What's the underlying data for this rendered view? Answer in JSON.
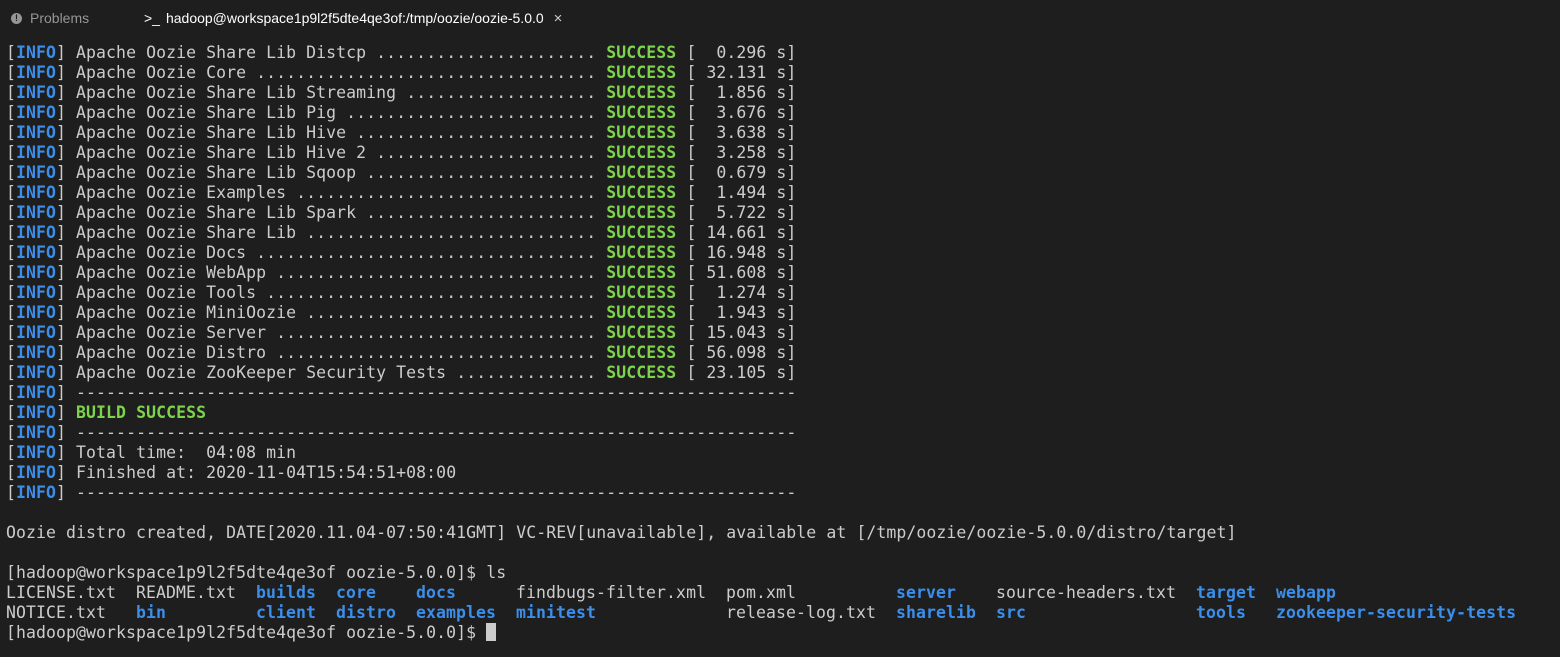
{
  "tabs": {
    "problems": "Problems",
    "terminal_prompt_icon": ">_",
    "terminal": "hadoop@workspace1p9l2f5dte4qe3of:/tmp/oozie/oozie-5.0.0",
    "close": "×"
  },
  "info_tag": "INFO",
  "build_results": [
    {
      "module": "Apache Oozie Share Lib Distcp ",
      "dots": "......................",
      "status": "SUCCESS",
      "time": "[  0.296 s]"
    },
    {
      "module": "Apache Oozie Core ",
      "dots": "..................................",
      "status": "SUCCESS",
      "time": "[ 32.131 s]"
    },
    {
      "module": "Apache Oozie Share Lib Streaming ",
      "dots": "...................",
      "status": "SUCCESS",
      "time": "[  1.856 s]"
    },
    {
      "module": "Apache Oozie Share Lib Pig ",
      "dots": ".........................",
      "status": "SUCCESS",
      "time": "[  3.676 s]"
    },
    {
      "module": "Apache Oozie Share Lib Hive ",
      "dots": "........................",
      "status": "SUCCESS",
      "time": "[  3.638 s]"
    },
    {
      "module": "Apache Oozie Share Lib Hive 2 ",
      "dots": "......................",
      "status": "SUCCESS",
      "time": "[  3.258 s]"
    },
    {
      "module": "Apache Oozie Share Lib Sqoop ",
      "dots": ".......................",
      "status": "SUCCESS",
      "time": "[  0.679 s]"
    },
    {
      "module": "Apache Oozie Examples ",
      "dots": "..............................",
      "status": "SUCCESS",
      "time": "[  1.494 s]"
    },
    {
      "module": "Apache Oozie Share Lib Spark ",
      "dots": ".......................",
      "status": "SUCCESS",
      "time": "[  5.722 s]"
    },
    {
      "module": "Apache Oozie Share Lib ",
      "dots": ".............................",
      "status": "SUCCESS",
      "time": "[ 14.661 s]"
    },
    {
      "module": "Apache Oozie Docs ",
      "dots": "..................................",
      "status": "SUCCESS",
      "time": "[ 16.948 s]"
    },
    {
      "module": "Apache Oozie WebApp ",
      "dots": "................................",
      "status": "SUCCESS",
      "time": "[ 51.608 s]"
    },
    {
      "module": "Apache Oozie Tools ",
      "dots": ".................................",
      "status": "SUCCESS",
      "time": "[  1.274 s]"
    },
    {
      "module": "Apache Oozie MiniOozie ",
      "dots": ".............................",
      "status": "SUCCESS",
      "time": "[  1.943 s]"
    },
    {
      "module": "Apache Oozie Server ",
      "dots": "................................",
      "status": "SUCCESS",
      "time": "[ 15.043 s]"
    },
    {
      "module": "Apache Oozie Distro ",
      "dots": "................................",
      "status": "SUCCESS",
      "time": "[ 56.098 s]"
    },
    {
      "module": "Apache Oozie ZooKeeper Security Tests ",
      "dots": "..............",
      "status": "SUCCESS",
      "time": "[ 23.105 s]"
    }
  ],
  "separator": "------------------------------------------------------------------------",
  "build_success": "BUILD SUCCESS",
  "total_time": "Total time:  04:08 min",
  "finished_at": "Finished at: 2020-11-04T15:54:51+08:00",
  "distro_message": "Oozie distro created, DATE[2020.11.04-07:50:41GMT] VC-REV[unavailable], available at [/tmp/oozie/oozie-5.0.0/distro/target]",
  "prompt": "[hadoop@workspace1p9l2f5dte4qe3of oozie-5.0.0]$ ",
  "command": "ls",
  "ls_output": [
    {
      "name": "LICENSE.txt",
      "type": "file"
    },
    {
      "name": "README.txt",
      "type": "file"
    },
    {
      "name": "builds",
      "type": "dir"
    },
    {
      "name": "core",
      "type": "dir"
    },
    {
      "name": "docs",
      "type": "dir"
    },
    {
      "name": "findbugs-filter.xml",
      "type": "file"
    },
    {
      "name": "pom.xml",
      "type": "file"
    },
    {
      "name": "server",
      "type": "dir"
    },
    {
      "name": "source-headers.txt",
      "type": "file"
    },
    {
      "name": "target",
      "type": "dir"
    },
    {
      "name": "webapp",
      "type": "dir"
    },
    {
      "name": "NOTICE.txt",
      "type": "file"
    },
    {
      "name": "bin",
      "type": "dir"
    },
    {
      "name": "client",
      "type": "dir"
    },
    {
      "name": "distro",
      "type": "dir"
    },
    {
      "name": "examples",
      "type": "dir"
    },
    {
      "name": "minitest",
      "type": "dir"
    },
    {
      "name": "release-log.txt",
      "type": "file"
    },
    {
      "name": "sharelib",
      "type": "dir"
    },
    {
      "name": "src",
      "type": "dir"
    },
    {
      "name": "tools",
      "type": "dir"
    },
    {
      "name": "zookeeper-security-tests",
      "type": "dir"
    }
  ],
  "colors": {
    "background": "#1e1e1e",
    "info": "#3b8eea",
    "success": "#7dd44a",
    "directory": "#3b8eea",
    "text": "#cccccc"
  }
}
